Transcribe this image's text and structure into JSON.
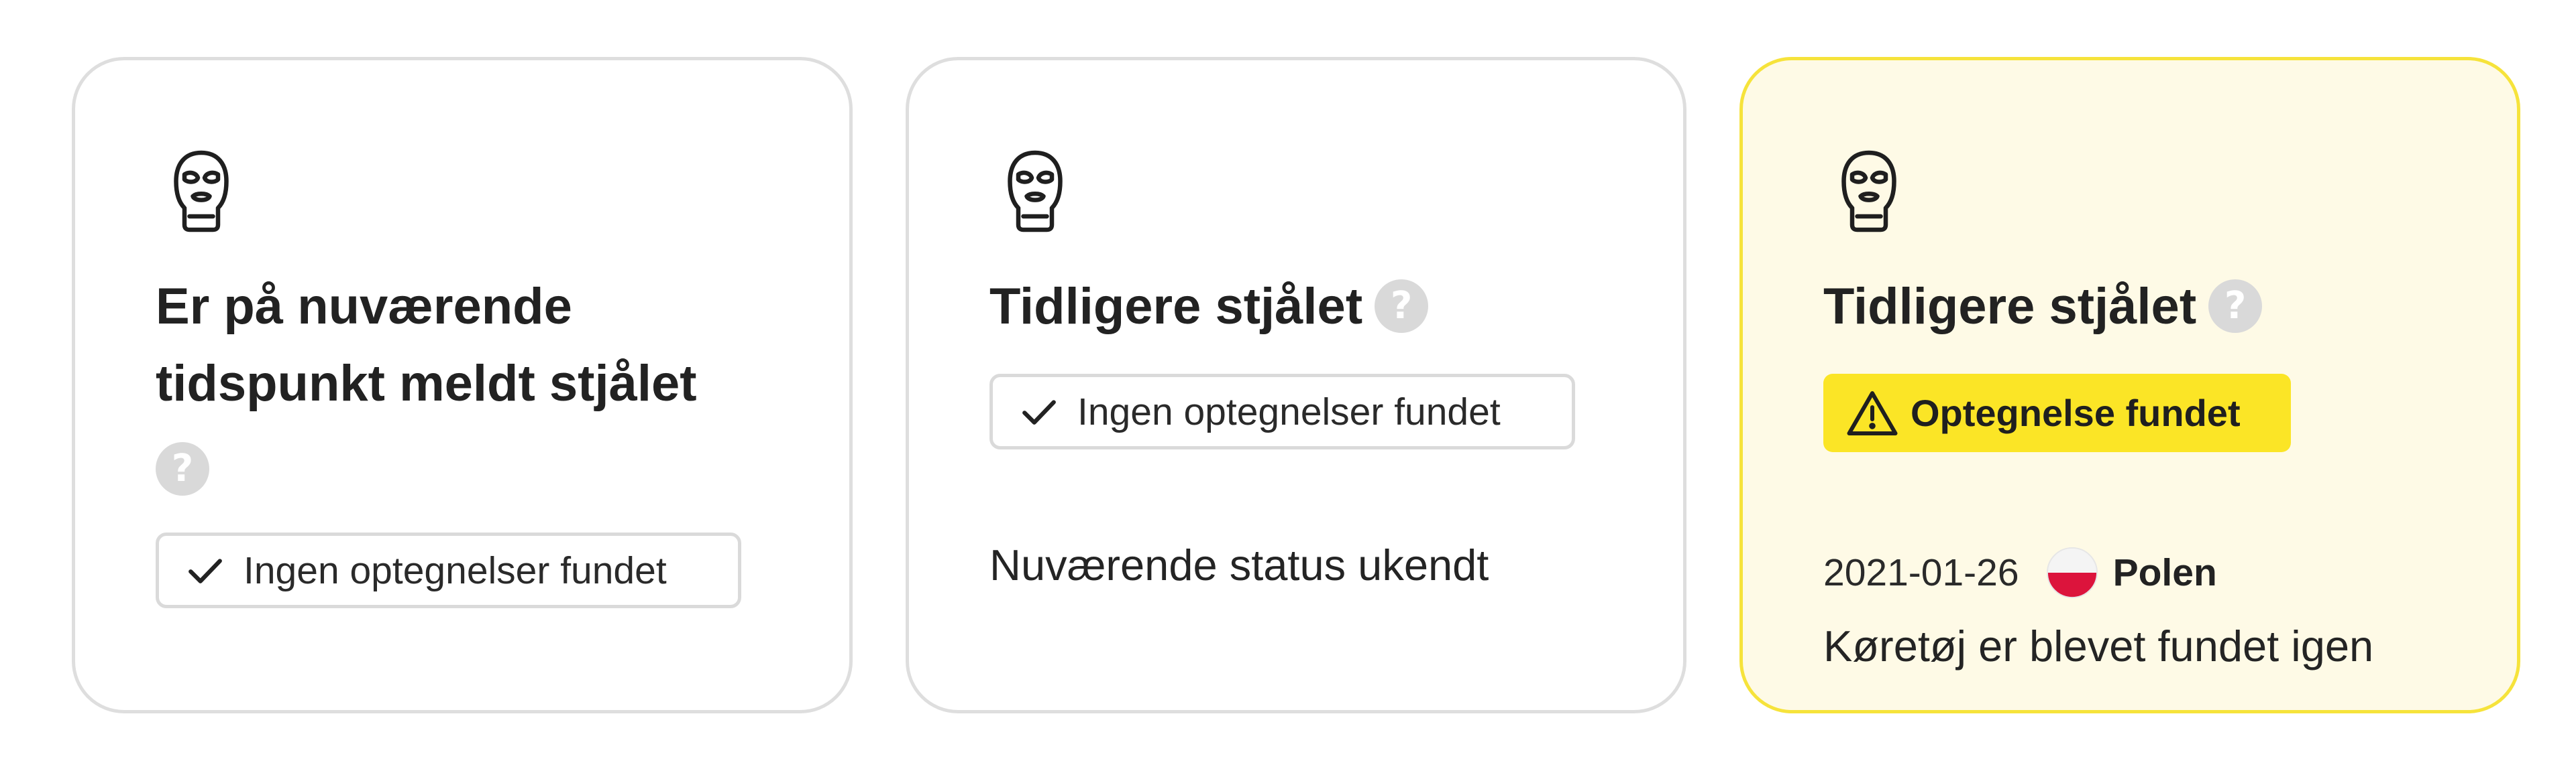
{
  "cards": [
    {
      "icon": "balaclava-icon",
      "title": "Er på nuværende tidspunkt meldt stjålet",
      "help_icon": "question-mark-icon",
      "status": {
        "icon": "check-icon",
        "label": "Ingen optegnelser fundet"
      }
    },
    {
      "icon": "balaclava-icon",
      "title": "Tidligere stjålet",
      "help_icon": "question-mark-icon",
      "status": {
        "icon": "check-icon",
        "label": "Ingen optegnelser fundet"
      },
      "description": "Nuværende status ukendt"
    },
    {
      "icon": "balaclava-icon",
      "title": "Tidligere stjålet",
      "help_icon": "question-mark-icon",
      "alert": {
        "icon": "warning-icon",
        "label": "Optegnelse fundet"
      },
      "record": {
        "date": "2021-01-26",
        "flag_icon": "poland-flag-icon",
        "country": "Polen"
      },
      "description": "Køretøj er blevet fundet igen"
    }
  ],
  "help_glyph": "?",
  "colors": {
    "card_border": "#dedede",
    "alert_background": "#fefae6",
    "alert_border": "#f6e33b",
    "badge_yellow": "#fbe526",
    "help_grey": "#d9d9d9",
    "flag_red": "#dc143c"
  }
}
